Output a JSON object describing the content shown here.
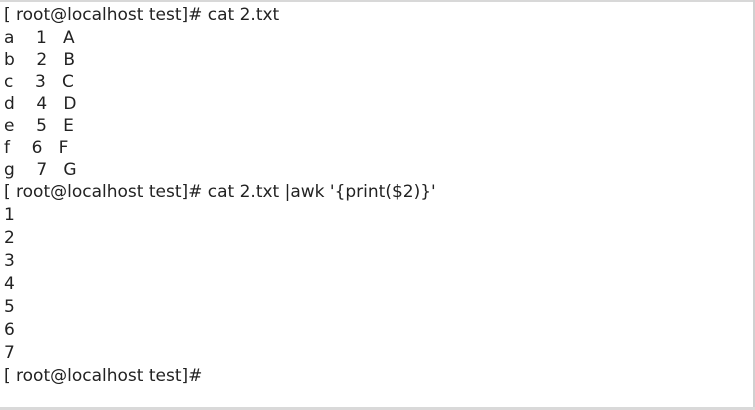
{
  "terminal": {
    "lines": [
      "[ root@localhost test]# cat 2.txt",
      "a    1   A",
      "b    2   B",
      "c    3   C",
      "d    4   D",
      "e    5   E",
      "f    6   F",
      "g    7   G",
      "[ root@localhost test]# cat 2.txt |awk '{print($2)}'",
      "1",
      "2",
      "3",
      "4",
      "5",
      "6",
      "7",
      "[ root@localhost test]# "
    ]
  }
}
